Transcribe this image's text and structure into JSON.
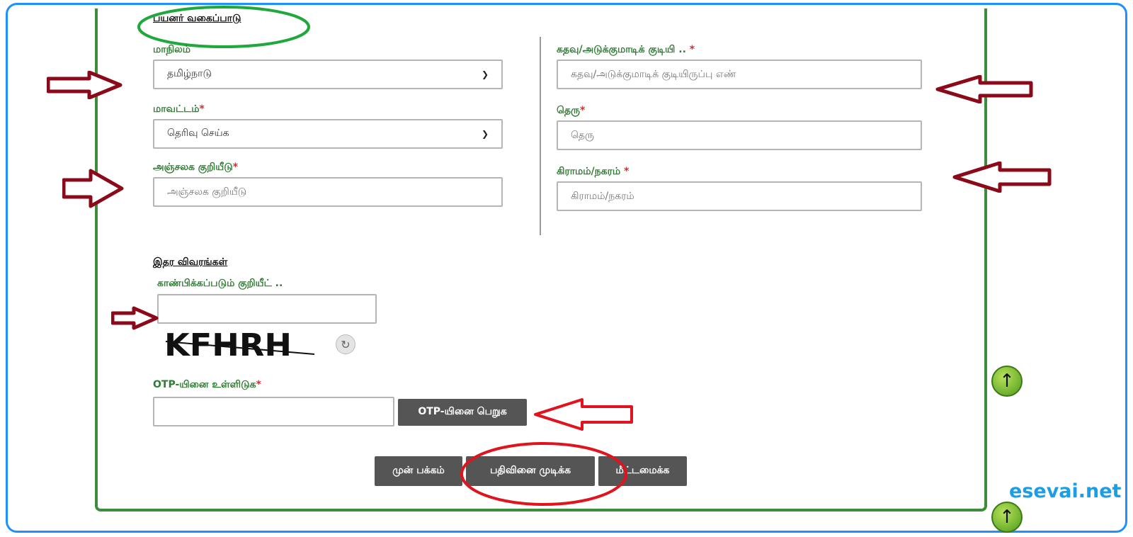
{
  "section": {
    "user_category": "பயனர் வகைப்பாடு",
    "other_details": "இதர விவரங்கள்"
  },
  "fields": {
    "state": {
      "label": "மாநிலம்",
      "value": "தமிழ்நாடு"
    },
    "district": {
      "label": "மாவட்டம்",
      "value": "தெரிவு செய்க"
    },
    "pincode": {
      "label": "அஞ்சலக குறியீடு",
      "placeholder": "அஞ்சலக குறியீடு"
    },
    "door_no": {
      "label": "கதவு/அடுக்குமாடிக் குடியி ..",
      "placeholder": "கதவு/அடுக்குமாடிக் குடியிருப்பு எண்"
    },
    "street": {
      "label": "தெரு",
      "placeholder": "தெரு"
    },
    "village": {
      "label": "கிராமம்/நகரம்",
      "placeholder": "கிராமம்/நகரம்"
    },
    "captcha": {
      "label": "காண்பிக்கப்படும் குறியீட் ..",
      "image_text": "KFHRH"
    },
    "otp": {
      "label": "OTP-யினை உள்ளிடுக"
    }
  },
  "required_mark": "*",
  "buttons": {
    "get_otp": "OTP-யினை பெறுக",
    "previous": "முன் பக்கம்",
    "complete": "பதிவினை முடிக்க",
    "reset": "மீட்டமைக்க"
  },
  "brand": "esevai.net",
  "icons": {
    "chevron": "chevron-down-icon",
    "refresh": "refresh-icon",
    "scroll_up": "arrow-up-icon"
  },
  "colors": {
    "label_green": "#2e7d32",
    "panel_border": "#3c8c3c",
    "frame_blue": "#1e90ff",
    "button_gray": "#555555",
    "annotation_dark_red": "#8b0a1a",
    "annotation_red": "#e0141e",
    "annotation_green": "#1fa83c",
    "brand_blue": "#1a9ee6"
  }
}
